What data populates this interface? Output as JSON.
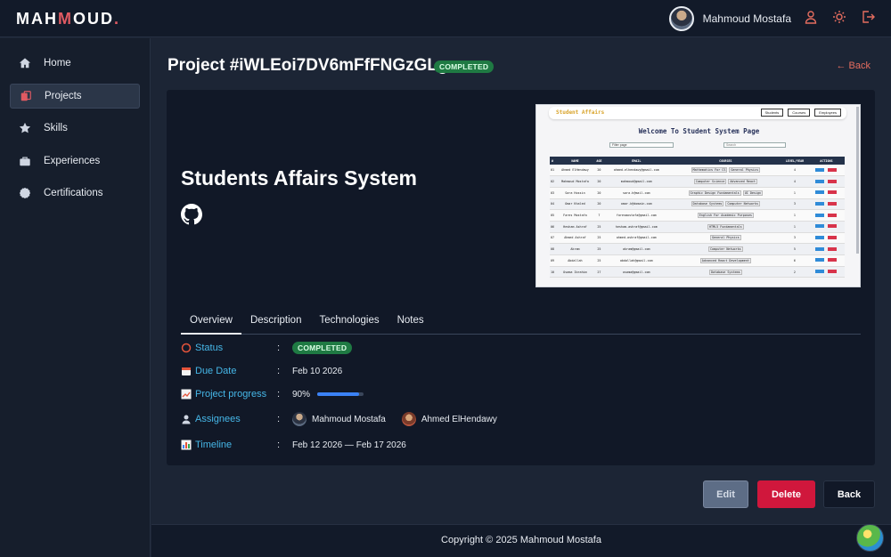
{
  "brand": {
    "logo_part1": "MAH",
    "logo_part2": "M",
    "logo_part3": "OUD",
    "logo_dot": "."
  },
  "user": {
    "name": "Mahmoud Mostafa"
  },
  "top_icons": [
    "user-icon",
    "sun-icon",
    "logout-icon"
  ],
  "sidebar": {
    "items": [
      {
        "label": "Home",
        "icon": "home-icon",
        "active": false
      },
      {
        "label": "Projects",
        "icon": "projects-icon",
        "active": true
      },
      {
        "label": "Skills",
        "icon": "star-icon",
        "active": false
      },
      {
        "label": "Experiences",
        "icon": "briefcase-icon",
        "active": false
      },
      {
        "label": "Certifications",
        "icon": "badge-icon",
        "active": false
      }
    ]
  },
  "header": {
    "title": "Project #iWLEoi7DV6mFfFNGzGLg",
    "status_badge": "COMPLETED",
    "back_label": "← Back"
  },
  "project": {
    "name": "Students Affairs System",
    "screenshot": {
      "brand": "Student Affairs",
      "nav": [
        "Students",
        "Courses",
        "Employees"
      ],
      "welcome": "Welcome To Student System Page",
      "select": "Filter page",
      "search": "Search",
      "columns": [
        "#",
        "NAME",
        "AGE",
        "EMAIL",
        "COURSES",
        "LEVEL/YEAR",
        "ACTIONS"
      ],
      "rows": [
        [
          "01",
          "Ahmed ElHendawy",
          "20",
          "ahmed.elhendawy@gmail.com",
          "Mathematics For CS | General Physics",
          "4"
        ],
        [
          "02",
          "Mahmoud Mostafa",
          "20",
          "mahmoud@gmail.com",
          "Computer Science | Advanced React",
          "4"
        ],
        [
          "03",
          "Sara Hossin",
          "20",
          "sara.h@mail.com",
          "Graphic Design Fundamentals | UI Design",
          "1"
        ],
        [
          "04",
          "Omar Khaled",
          "20",
          "omar.k@domain.com",
          "Database Systems | Computer Networks",
          "3"
        ],
        [
          "05",
          "Fares Mostafa",
          "7",
          "faresmostafa@gmail.com",
          "English For Academic Purposes",
          "1"
        ],
        [
          "06",
          "Hesham Ashraf",
          "25",
          "hesham.ashraf@gmail.com",
          "HTML5 Fundamentals",
          "1"
        ],
        [
          "07",
          "Ahmed Ashraf",
          "25",
          "ahmed.ashraf@gmail.com",
          "General Physics",
          "3"
        ],
        [
          "08",
          "Akram",
          "25",
          "akram@gmail.com",
          "Computer Networks",
          "5"
        ],
        [
          "09",
          "Abdallah",
          "25",
          "abdallah@gmail.com",
          "Advanced React Development",
          "6"
        ],
        [
          "10",
          "Osama Ibrahim",
          "27",
          "osama@gmail.com",
          "Database Systems",
          "2"
        ]
      ],
      "edit_label": "Edit",
      "delete_label": "Delete"
    }
  },
  "tabs": [
    "Overview",
    "Description",
    "Technologies",
    "Notes"
  ],
  "overview": {
    "status": {
      "label": "Status",
      "value": "COMPLETED"
    },
    "due_date": {
      "label": "Due Date",
      "value": "Feb 10 2026"
    },
    "progress": {
      "label": "Project progress",
      "value": "90%",
      "fraction": 0.9
    },
    "assignees": {
      "label": "Assignees",
      "people": [
        "Mahmoud Mostafa",
        "Ahmed ElHendawy"
      ]
    },
    "timeline": {
      "label": "Timeline",
      "value": "Feb 12 2026 — Feb 17 2026"
    },
    "colon": ":"
  },
  "actions": {
    "edit": "Edit",
    "delete": "Delete",
    "back": "Back"
  },
  "footer": {
    "text": "Copyright © 2025 Mahmoud Mostafa"
  },
  "colors": {
    "accent": "#e56d5f",
    "status_green": "#1f7a43",
    "label_blue": "#46b7e8",
    "danger": "#d0173c",
    "progress": "#3b82f6"
  }
}
